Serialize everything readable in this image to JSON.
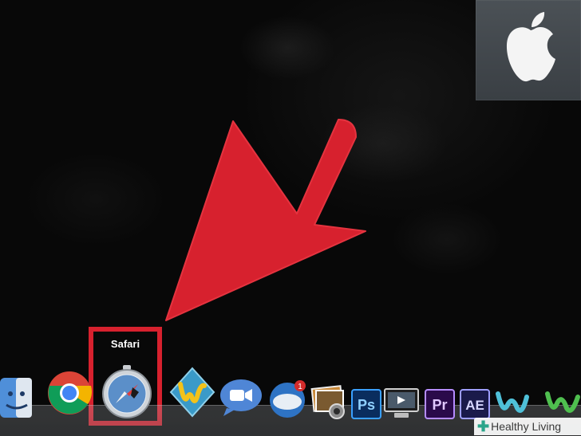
{
  "dock": {
    "tooltip": "Safari",
    "items": [
      {
        "name": "Finder",
        "icon": "finder-icon"
      },
      {
        "name": "Chrome",
        "icon": "chrome-icon"
      },
      {
        "name": "Safari",
        "icon": "safari-icon"
      },
      {
        "name": "Wunderlist",
        "icon": "w-app-icon"
      },
      {
        "name": "FaceTime",
        "icon": "facetime-icon"
      },
      {
        "name": "Mail",
        "icon": "mail-icon"
      },
      {
        "name": "Image Capture",
        "icon": "photos-icon"
      },
      {
        "name": "Photoshop",
        "icon": "photoshop-icon",
        "label": "Ps"
      },
      {
        "name": "DVD Player",
        "icon": "dvd-player-icon"
      },
      {
        "name": "Premiere",
        "icon": "premiere-icon",
        "label": "Pr"
      },
      {
        "name": "After Effects",
        "icon": "after-effects-icon",
        "label": "AE"
      }
    ]
  },
  "watermark": {
    "text": "Healthy Living"
  },
  "colors": {
    "arrow": "#d7212e",
    "highlight": "#d7212e"
  }
}
